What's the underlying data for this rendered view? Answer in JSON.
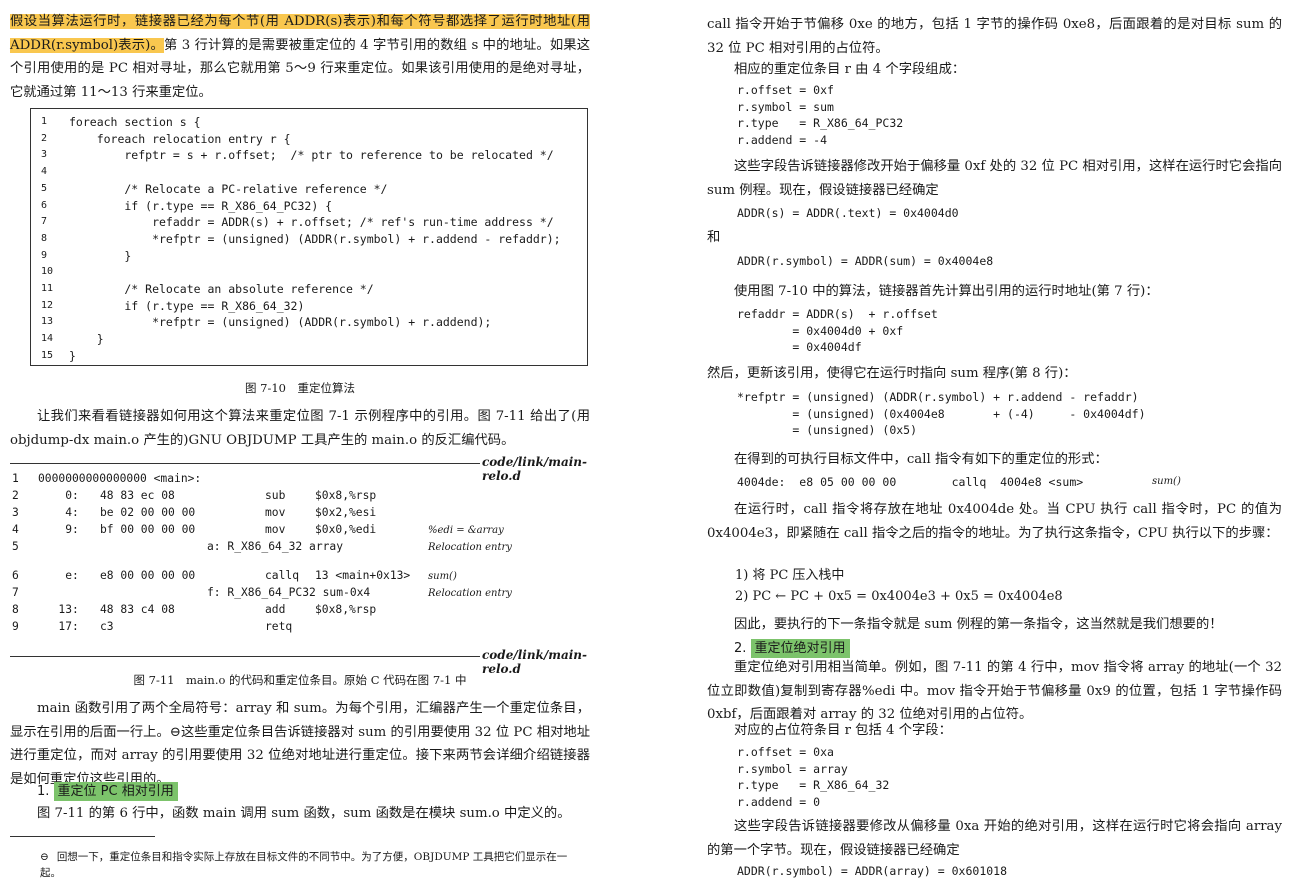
{
  "left": {
    "para1": {
      "hl": "假设当算法运行时，链接器已经为每个节(用 ADDR(s)表示)和每个符号都选择了运行时地址(用 ADDR(r.symbol)表示)。",
      "rest": "第 3 行计算的是需要被重定位的 4 字节引用的数组 s 中的地址。如果这个引用使用的是 PC 相对寻址，那么它就用第 5～9 行来重定位。如果该引用使用的是绝对寻址，它就通过第 11～13 行来重定位。"
    },
    "figure_710": {
      "lines": [
        {
          "n": "1",
          "code": "foreach section s {"
        },
        {
          "n": "2",
          "code": "    foreach relocation entry r {"
        },
        {
          "n": "3",
          "code": "        refptr = s + r.offset;  /* ptr to reference to be relocated */"
        },
        {
          "n": "4",
          "code": ""
        },
        {
          "n": "5",
          "code": "        /* Relocate a PC-relative reference */"
        },
        {
          "n": "6",
          "code": "        if (r.type == R_X86_64_PC32) {"
        },
        {
          "n": "7",
          "code": "            refaddr = ADDR(s) + r.offset; /* ref's run-time address */"
        },
        {
          "n": "8",
          "code": "            *refptr = (unsigned) (ADDR(r.symbol) + r.addend - refaddr);"
        },
        {
          "n": "9",
          "code": "        }"
        },
        {
          "n": "10",
          "code": ""
        },
        {
          "n": "11",
          "code": "        /* Relocate an absolute reference */"
        },
        {
          "n": "12",
          "code": "        if (r.type == R_X86_64_32)"
        },
        {
          "n": "13",
          "code": "            *refptr = (unsigned) (ADDR(r.symbol) + r.addend);"
        },
        {
          "n": "14",
          "code": "    }"
        },
        {
          "n": "15",
          "code": "}"
        }
      ],
      "caption": "图 7-10　重定位算法"
    },
    "para2": "让我们来看看链接器如何用这个算法来重定位图 7-1 示例程序中的引用。图 7-11 给出了(用 objdump-dx main.o 产生的)GNU OBJDUMP 工具产生的 main.o 的反汇编代码。",
    "file_label": "code/link/main-relo.d",
    "dump": [
      {
        "n": "1",
        "addr": "0000000000000000 <main>:",
        "bytes": "",
        "op": "",
        "args": "",
        "note": ""
      },
      {
        "n": "2",
        "addr": "    0:",
        "bytes": "48 83 ec 08",
        "op": "sub",
        "args": "$0x8,%rsp",
        "note": ""
      },
      {
        "n": "3",
        "addr": "    4:",
        "bytes": "be 02 00 00 00",
        "op": "mov",
        "args": "$0x2,%esi",
        "note": ""
      },
      {
        "n": "4",
        "addr": "    9:",
        "bytes": "bf 00 00 00 00",
        "op": "mov",
        "args": "$0x0,%edi",
        "note": "%edi = &array"
      },
      {
        "n": "5",
        "addr": "",
        "bytes": "a: R_X86_64_32 array",
        "op": "",
        "args": "",
        "note": "Relocation entry"
      },
      {
        "n": "6",
        "addr": "    e:",
        "bytes": "e8 00 00 00 00",
        "op": "callq",
        "args": "13 <main+0x13>",
        "note": "sum()"
      },
      {
        "n": "7",
        "addr": "",
        "bytes": "f: R_X86_64_PC32 sum-0x4",
        "op": "",
        "args": "",
        "note": "Relocation entry"
      },
      {
        "n": "8",
        "addr": "   13:",
        "bytes": "48 83 c4 08",
        "op": "add",
        "args": "$0x8,%rsp",
        "note": ""
      },
      {
        "n": "9",
        "addr": "   17:",
        "bytes": "c3",
        "op": "retq",
        "args": "",
        "note": ""
      }
    ],
    "caption_711": "图 7-11　main.o 的代码和重定位条目。原始 C 代码在图 7-1 中",
    "para3": "main 函数引用了两个全局符号：array 和 sum。为每个引用，汇编器产生一个重定位条目，显示在引用的后面一行上。⊖这些重定位条目告诉链接器对 sum 的引用要使用 32 位 PC 相对地址进行重定位，而对 array 的引用要使用 32 位绝对地址进行重定位。接下来两节会详细介绍链接器是如何重定位这些引用的。",
    "section1_num": "1.",
    "section1_title": "重定位 PC 相对引用",
    "para4": "图 7-11 的第 6 行中，函数 main 调用 sum 函数，sum 函数是在模块 sum.o 中定义的。",
    "footnote_mark": "⊖",
    "footnote": "回想一下，重定位条目和指令实际上存放在目标文件的不同节中。为了方便，OBJDUMP 工具把它们显示在一起。"
  },
  "right": {
    "para1": "call 指令开始于节偏移 0xe 的地方，包括 1 字节的操作码 0xe8，后面跟着的是对目标 sum 的 32 位 PC 相对引用的占位符。",
    "para2": "相应的重定位条目 r 由 4 个字段组成：",
    "fields1": "r.offset = 0xf\nr.symbol = sum\nr.type   = R_X86_64_PC32\nr.addend = -4",
    "para3": "这些字段告诉链接器修改开始于偏移量 0xf 处的 32 位 PC 相对引用，这样在运行时它会指向 sum 例程。现在，假设链接器已经确定",
    "eq1": "ADDR(s) = ADDR(.text) = 0x4004d0",
    "and": "和",
    "eq2": "ADDR(r.symbol) = ADDR(sum) = 0x4004e8",
    "para4": "使用图 7-10 中的算法，链接器首先计算出引用的运行时地址(第 7 行)：",
    "refaddr": "refaddr = ADDR(s)  + r.offset\n        = 0x4004d0 + 0xf\n        = 0x4004df",
    "para5": "然后，更新该引用，使得它在运行时指向 sum 程序(第 8 行)：",
    "refptr": "*refptr = (unsigned) (ADDR(r.symbol) + r.addend - refaddr)\n        = (unsigned) (0x4004e8       + (-4)     - 0x4004df)\n        = (unsigned) (0x5)",
    "para6": "在得到的可执行目标文件中，call 指令有如下的重定位的形式：",
    "callform": "4004de:  e8 05 00 00 00        callq  4004e8 <sum>",
    "callnote": "sum()",
    "para7": "在运行时，call 指令将存放在地址 0x4004de 处。当 CPU 执行 call 指令时，PC 的值为 0x4004e3，即紧随在 call 指令之后的指令的地址。为了执行这条指令，CPU 执行以下的步骤：",
    "step1": "1) 将 PC 压入栈中",
    "step2": "2) PC  ←  PC + 0x5 = 0x4004e3 + 0x5 = 0x4004e8",
    "para8": "因此，要执行的下一条指令就是 sum 例程的第一条指令，这当然就是我们想要的！",
    "section2_num": "2.",
    "section2_title": "重定位绝对引用",
    "para9": "重定位绝对引用相当简单。例如，图 7-11 的第 4 行中，mov 指令将 array 的地址(一个 32 位立即数值)复制到寄存器%edi 中。mov 指令开始于节偏移量 0x9 的位置，包括 1 字节操作码 0xbf，后面跟着对 array 的 32 位绝对引用的占位符。",
    "para10": "对应的占位符条目 r 包括 4 个字段：",
    "fields2": "r.offset = 0xa\nr.symbol = array\nr.type   = R_X86_64_32\nr.addend = 0",
    "para11": "这些字段告诉链接器要修改从偏移量 0xa 开始的绝对引用，这样在运行时它将会指向 array 的第一个字节。现在，假设链接器已经确定",
    "eq3": "ADDR(r.symbol) = ADDR(array) = 0x601018"
  }
}
